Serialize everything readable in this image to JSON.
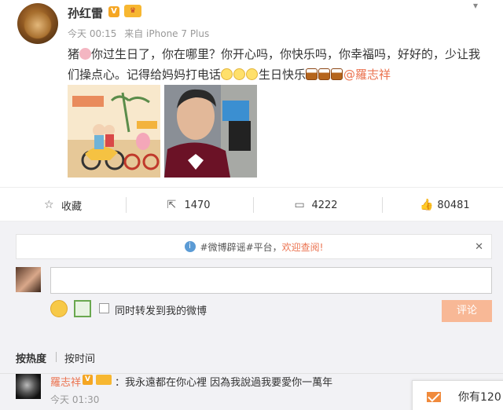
{
  "post": {
    "username": "孙红雷",
    "verified_badge": "V",
    "time": "今天 00:15",
    "source": "来自 iPhone 7 Plus",
    "text_part1": "猪",
    "text_part2": "你过生日了，你在哪里？你开心吗，你快乐吗，你幸福吗，好好的，少让我们操点心。记得给妈妈打电话",
    "text_part3": "生日快乐",
    "mention": "@羅志祥",
    "more_icon": "chevron-down-icon"
  },
  "actions": {
    "favorite_label": "收藏",
    "repost_count": "1470",
    "comment_count": "4222",
    "like_count": "80481"
  },
  "comment_box": {
    "notice_text": "#微博辟谣#平台，",
    "notice_welcome": "欢迎查阅!",
    "input_placeholder": "",
    "repost_label": "同时转发到我的微博",
    "submit_label": "评论"
  },
  "sort": {
    "by_hot": "按热度",
    "by_time": "按时间"
  },
  "comments": [
    {
      "name": "羅志祥",
      "badge": "V",
      "text": "：我永遠都在你心裡 因為我說過我要愛你一萬年",
      "time": "今天 01:30"
    }
  ],
  "toast": {
    "text": "你有120"
  },
  "colors": {
    "accent": "#eb7350",
    "submit_bg": "#f8b896",
    "badge": "#f5a623"
  }
}
